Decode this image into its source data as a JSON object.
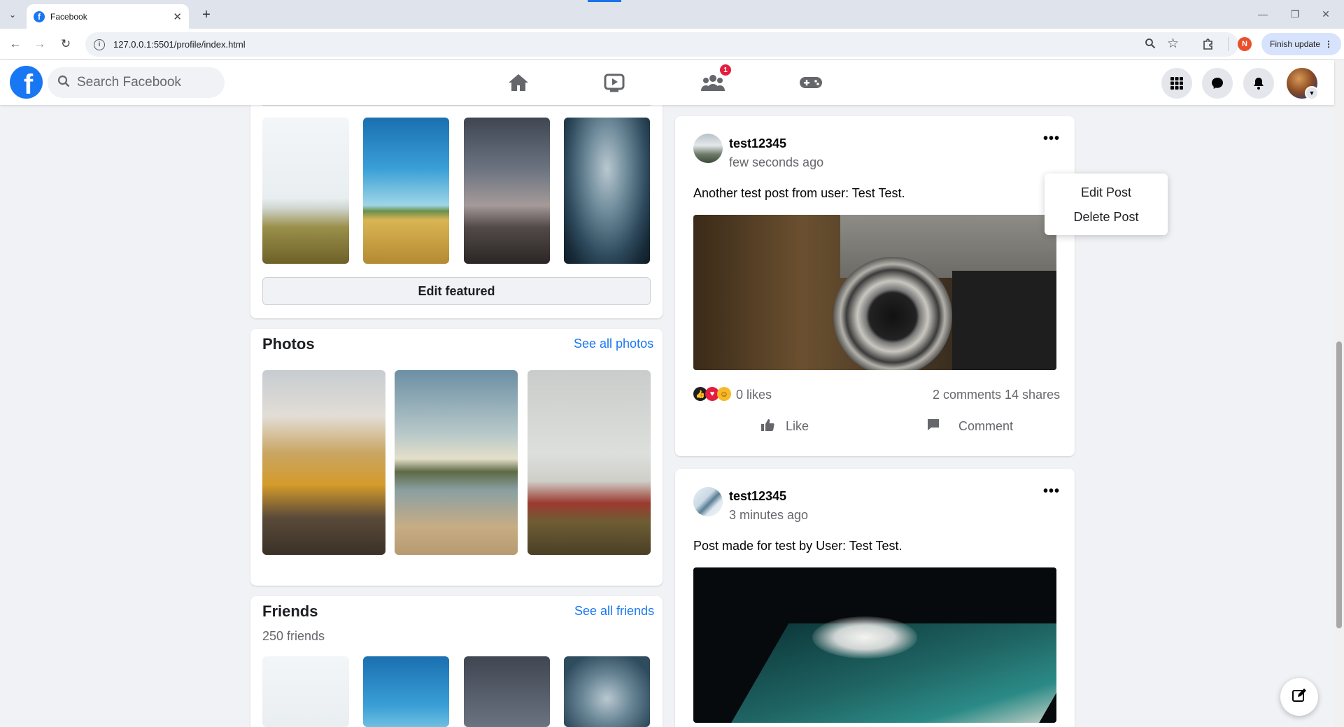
{
  "browser": {
    "tab_title": "Facebook",
    "url": "127.0.0.1:5501/profile/index.html",
    "profile_initial": "N",
    "finish_update_label": "Finish update"
  },
  "header": {
    "search_placeholder": "Search Facebook",
    "friends_badge": "1",
    "nav_icons": [
      "home-icon",
      "watch-icon",
      "groups-icon",
      "gaming-icon"
    ],
    "right_icons": [
      "menu-grid-icon",
      "messenger-icon",
      "bell-icon",
      "account-avatar"
    ]
  },
  "featured": {
    "edit_label": "Edit featured"
  },
  "photos": {
    "title": "Photos",
    "see_all": "See all photos"
  },
  "friends": {
    "title": "Friends",
    "see_all": "See all friends",
    "count_text": "250 friends"
  },
  "posts": [
    {
      "author": "test12345",
      "time": "few seconds ago",
      "text": "Another test post from user: Test Test.",
      "likes": "0 likes",
      "comments_shares": "2 comments 14 shares",
      "like_label": "Like",
      "comment_label": "Comment"
    },
    {
      "author": "test12345",
      "time": "3 minutes ago",
      "text": "Post made for test by User: Test Test."
    }
  ],
  "post_menu": {
    "edit": "Edit Post",
    "delete": "Delete Post"
  },
  "colors": {
    "brand": "#1877f2",
    "page_bg": "#f0f2f5",
    "badge": "#e41e3f"
  }
}
